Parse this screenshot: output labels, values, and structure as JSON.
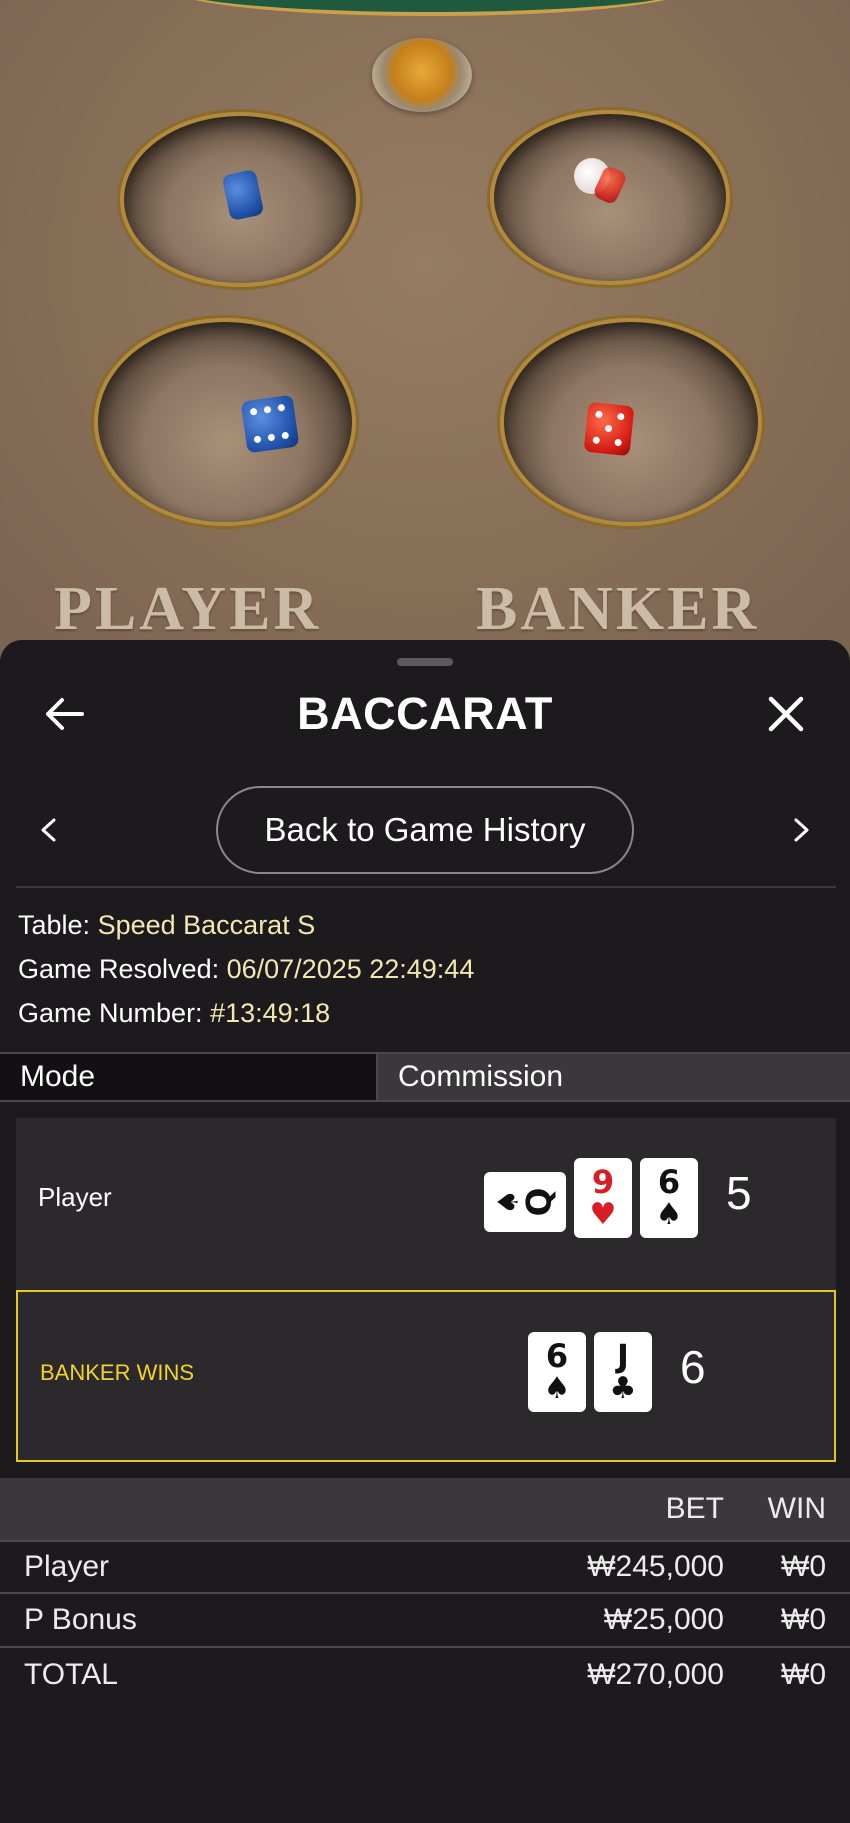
{
  "table_view": {
    "player_label": "PLAYER",
    "banker_label": "BANKER"
  },
  "sheet": {
    "title": "BACCARAT",
    "back_to_history": "Back to Game History",
    "info": {
      "table_label": "Table:",
      "table_value": "Speed Baccarat S",
      "resolved_label": "Game Resolved:",
      "resolved_value": "06/07/2025 22:49:44",
      "number_label": "Game Number:",
      "number_value": "#13:49:18"
    },
    "mode": {
      "label": "Mode",
      "value": "Commission"
    },
    "hands": {
      "player": {
        "label": "Player",
        "total": "5",
        "cards": [
          {
            "rank": "Q",
            "suit": "♠",
            "color": "black",
            "orientation": "sideways"
          },
          {
            "rank": "9",
            "suit": "♥",
            "color": "red"
          },
          {
            "rank": "6",
            "suit": "♠",
            "color": "black"
          }
        ]
      },
      "banker": {
        "label": "BANKER WINS",
        "total": "6",
        "cards": [
          {
            "rank": "6",
            "suit": "♠",
            "color": "black"
          },
          {
            "rank": "J",
            "suit": "♣",
            "color": "black"
          }
        ]
      }
    },
    "bets": {
      "headers": {
        "bet": "BET",
        "win": "WIN"
      },
      "rows": [
        {
          "name": "Player",
          "bet": "₩245,000",
          "win": "₩0"
        },
        {
          "name": "P Bonus",
          "bet": "₩25,000",
          "win": "₩0"
        },
        {
          "name": "TOTAL",
          "bet": "₩270,000",
          "win": "₩0"
        }
      ]
    }
  },
  "colors": {
    "accent_gold": "#f4d22a",
    "info_value": "#f2e7b0",
    "sheet_bg": "#1c1a1c",
    "winner_border": "#e6c620"
  },
  "icons": {
    "back": "arrow-left-icon",
    "close": "close-icon",
    "prev": "chevron-left-icon",
    "next": "chevron-right-icon"
  }
}
